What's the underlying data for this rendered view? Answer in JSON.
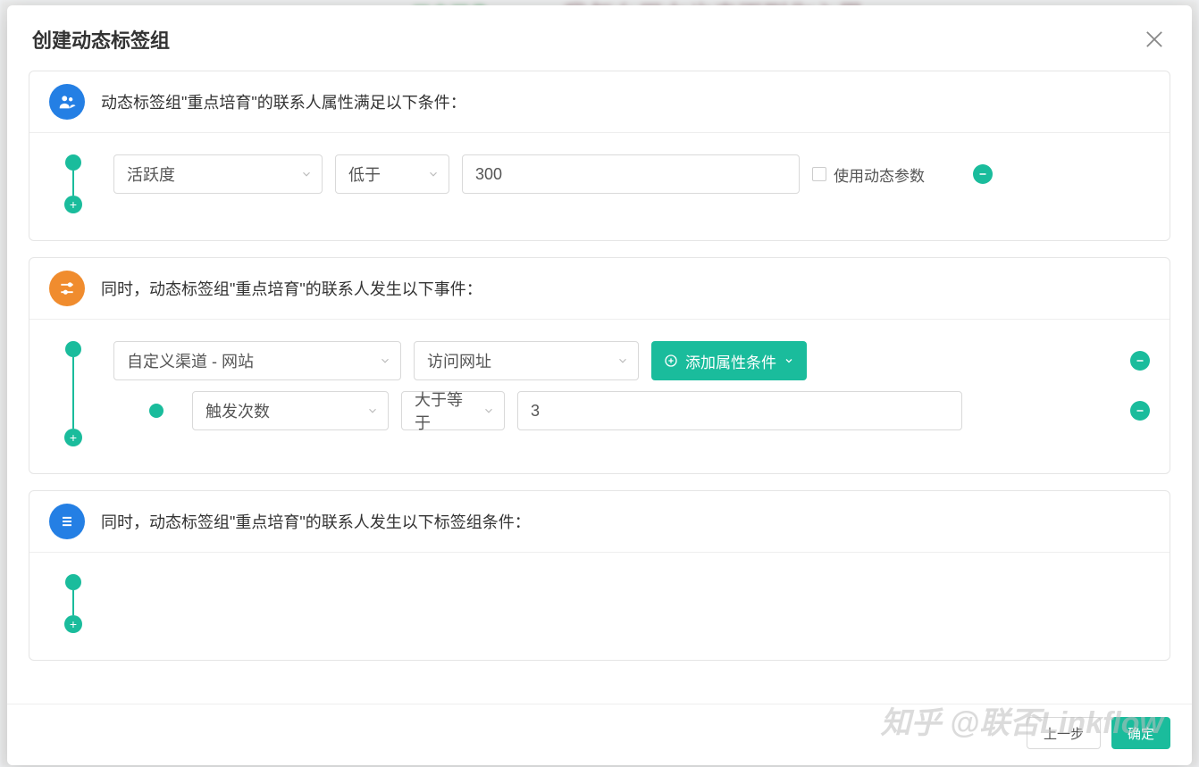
{
  "backdrop": {
    "tab_label": "用户画像",
    "overlay_text": "我怎么用力也走不到你心里"
  },
  "modal": {
    "title": "创建动态标签组",
    "footer": {
      "prev": "上一步",
      "confirm": "确定"
    }
  },
  "section1": {
    "title": "动态标签组\"重点培育\"的联系人属性满足以下条件：",
    "row": {
      "field": "活跃度",
      "operator": "低于",
      "value": "300",
      "dynamic_param_label": "使用动态参数"
    }
  },
  "section2": {
    "title": "同时，动态标签组\"重点培育\"的联系人发生以下事件：",
    "row1": {
      "channel": "自定义渠道 - 网站",
      "event": "访问网址",
      "add_attr": "添加属性条件"
    },
    "row2": {
      "metric": "触发次数",
      "operator": "大于等于",
      "value": "3"
    }
  },
  "section3": {
    "title": "同时，动态标签组\"重点培育\"的联系人发生以下标签组条件："
  },
  "watermark": "知乎 @联否Linkflow"
}
